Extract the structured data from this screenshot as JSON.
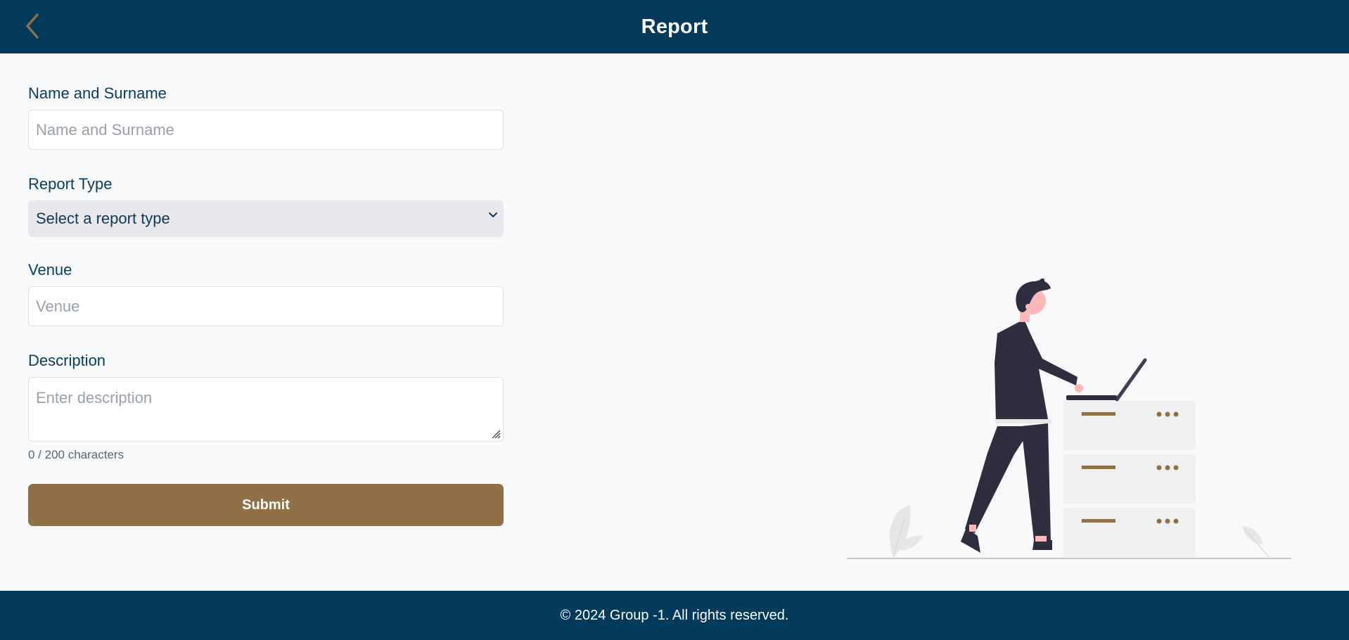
{
  "header": {
    "title": "Report",
    "back_icon": "chevron-left-icon",
    "accent": "#8f7047",
    "background": "#013a5b"
  },
  "form": {
    "name": {
      "label": "Name and Surname",
      "placeholder": "Name and Surname",
      "value": ""
    },
    "report_type": {
      "label": "Report Type",
      "selected": "Select a report type",
      "icon": "chevron-down-icon"
    },
    "venue": {
      "label": "Venue",
      "placeholder": "Venue",
      "value": ""
    },
    "description": {
      "label": "Description",
      "placeholder": "Enter description",
      "value": "",
      "char_count": "0 / 200 characters"
    },
    "submit_label": "Submit",
    "submit_color": "#8f7047"
  },
  "illustration": {
    "icon": "person-at-laptop-illustration"
  },
  "footer": {
    "text": "© 2024 Group -1. All rights reserved."
  }
}
